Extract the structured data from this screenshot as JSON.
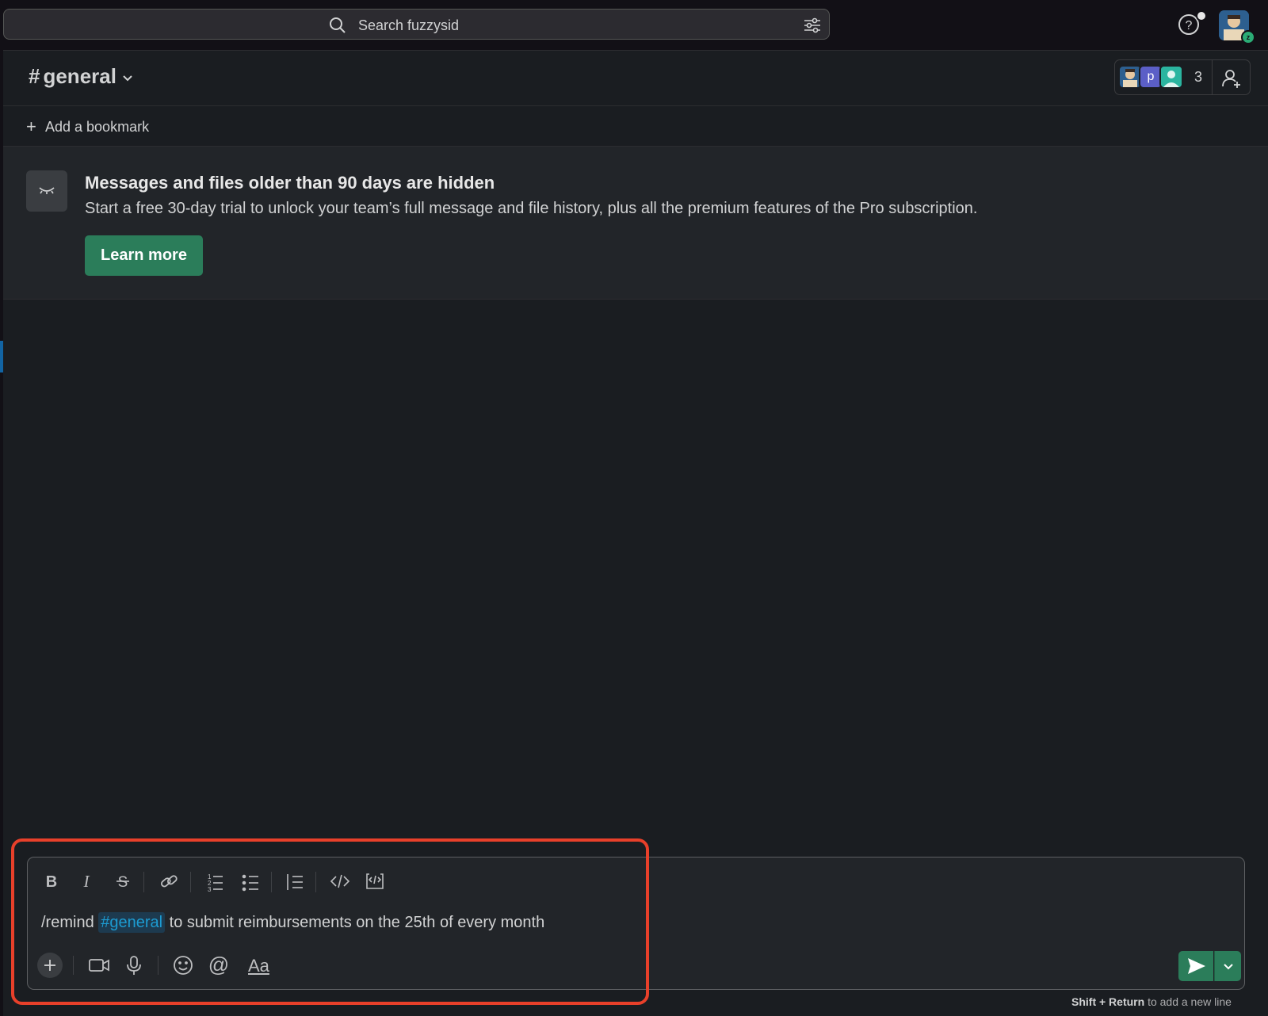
{
  "search": {
    "placeholder": "Search fuzzysid"
  },
  "channel": {
    "hash": "#",
    "name": "general",
    "member_count": "3",
    "member_initial": "p"
  },
  "bookmark": {
    "label": "Add a bookmark"
  },
  "notice": {
    "title": "Messages and files older than 90 days are hidden",
    "body": "Start a free 30-day trial to unlock your team’s full message and file history, plus all the premium features of the Pro subscription.",
    "button": "Learn more"
  },
  "composer": {
    "command": "/remind",
    "mention": "#general",
    "rest": "to submit reimbursements on the 25th of every month",
    "format_label": "Aa",
    "hint_keys": "Shift + Return",
    "hint_text": "to add a new line"
  },
  "user": {
    "status_letter": "z"
  },
  "colors": {
    "accent_green": "#2b7d5a",
    "mention_blue": "#1d9bd1",
    "highlight_red": "#e8402a"
  }
}
